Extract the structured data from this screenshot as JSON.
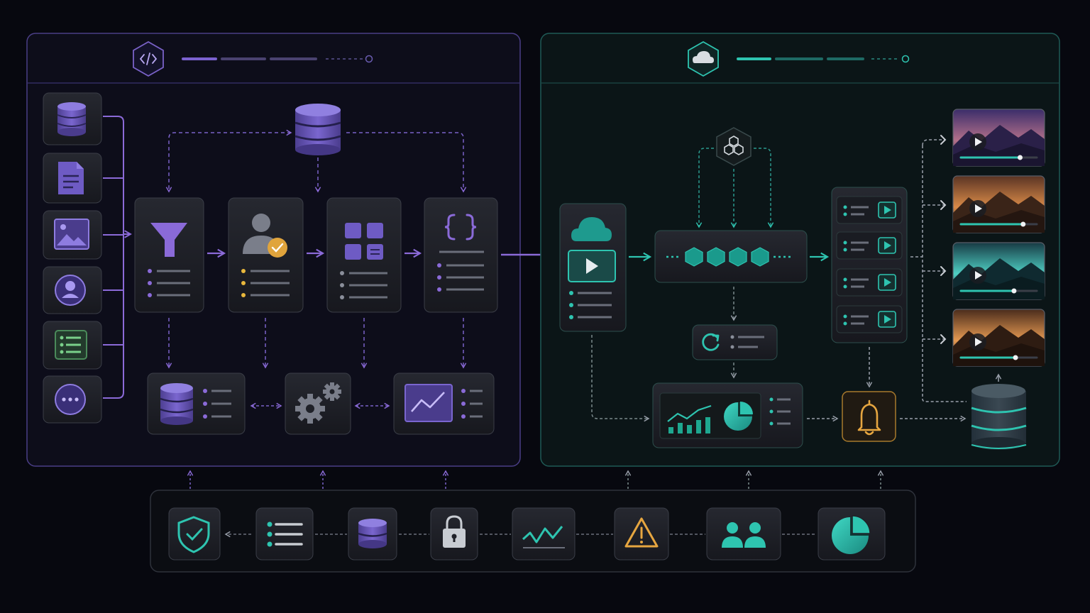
{
  "colors": {
    "background": "#07080f",
    "purple_accent": "#8b6ad8",
    "purple_icon": "#6e5bc4",
    "teal_accent": "#2ec4b0",
    "card_fill": "#1d1f26",
    "card_stroke": "#3a3d47",
    "orange_badge": "#e0a43c",
    "bell_amber": "#e6a640",
    "yellow_dot": "#e8b73c"
  },
  "left_panel": {
    "header_icon": "code-icon",
    "sources": [
      "database-icon",
      "document-icon",
      "image-icon",
      "user-profile-icon",
      "spreadsheet-icon",
      "more-icon"
    ],
    "top_store_icon": "database-icon",
    "pipeline": [
      "filter-icon",
      "user-approved-icon",
      "grid-layout-icon",
      "json-braces-icon"
    ],
    "bottom": [
      "database-list-icon",
      "gears-icon",
      "line-chart-icon"
    ]
  },
  "right_panel": {
    "header_icon": "cloud-icon",
    "ingest_icon": "cloud-play-icon",
    "model_icon": "hexagon-cluster-icon",
    "processing_icon": "hexagon-chain-icon",
    "retry_icon": "refresh-icon",
    "playlist_icon": "play-list-icon",
    "analytics_icon": "analytics-icon",
    "alert_icon": "bell-icon",
    "storage_icon": "database-icon",
    "videos": [
      {
        "theme": "purple-dusk",
        "progress": 0.78
      },
      {
        "theme": "orange-sunset",
        "progress": 0.82
      },
      {
        "theme": "teal-glow",
        "progress": 0.7
      },
      {
        "theme": "amber-sunset",
        "progress": 0.72
      }
    ]
  },
  "footer": {
    "icons": [
      "shield-check-icon",
      "list-icon",
      "database-icon",
      "lock-icon",
      "activity-icon",
      "warning-icon",
      "users-icon",
      "pie-chart-icon"
    ]
  }
}
